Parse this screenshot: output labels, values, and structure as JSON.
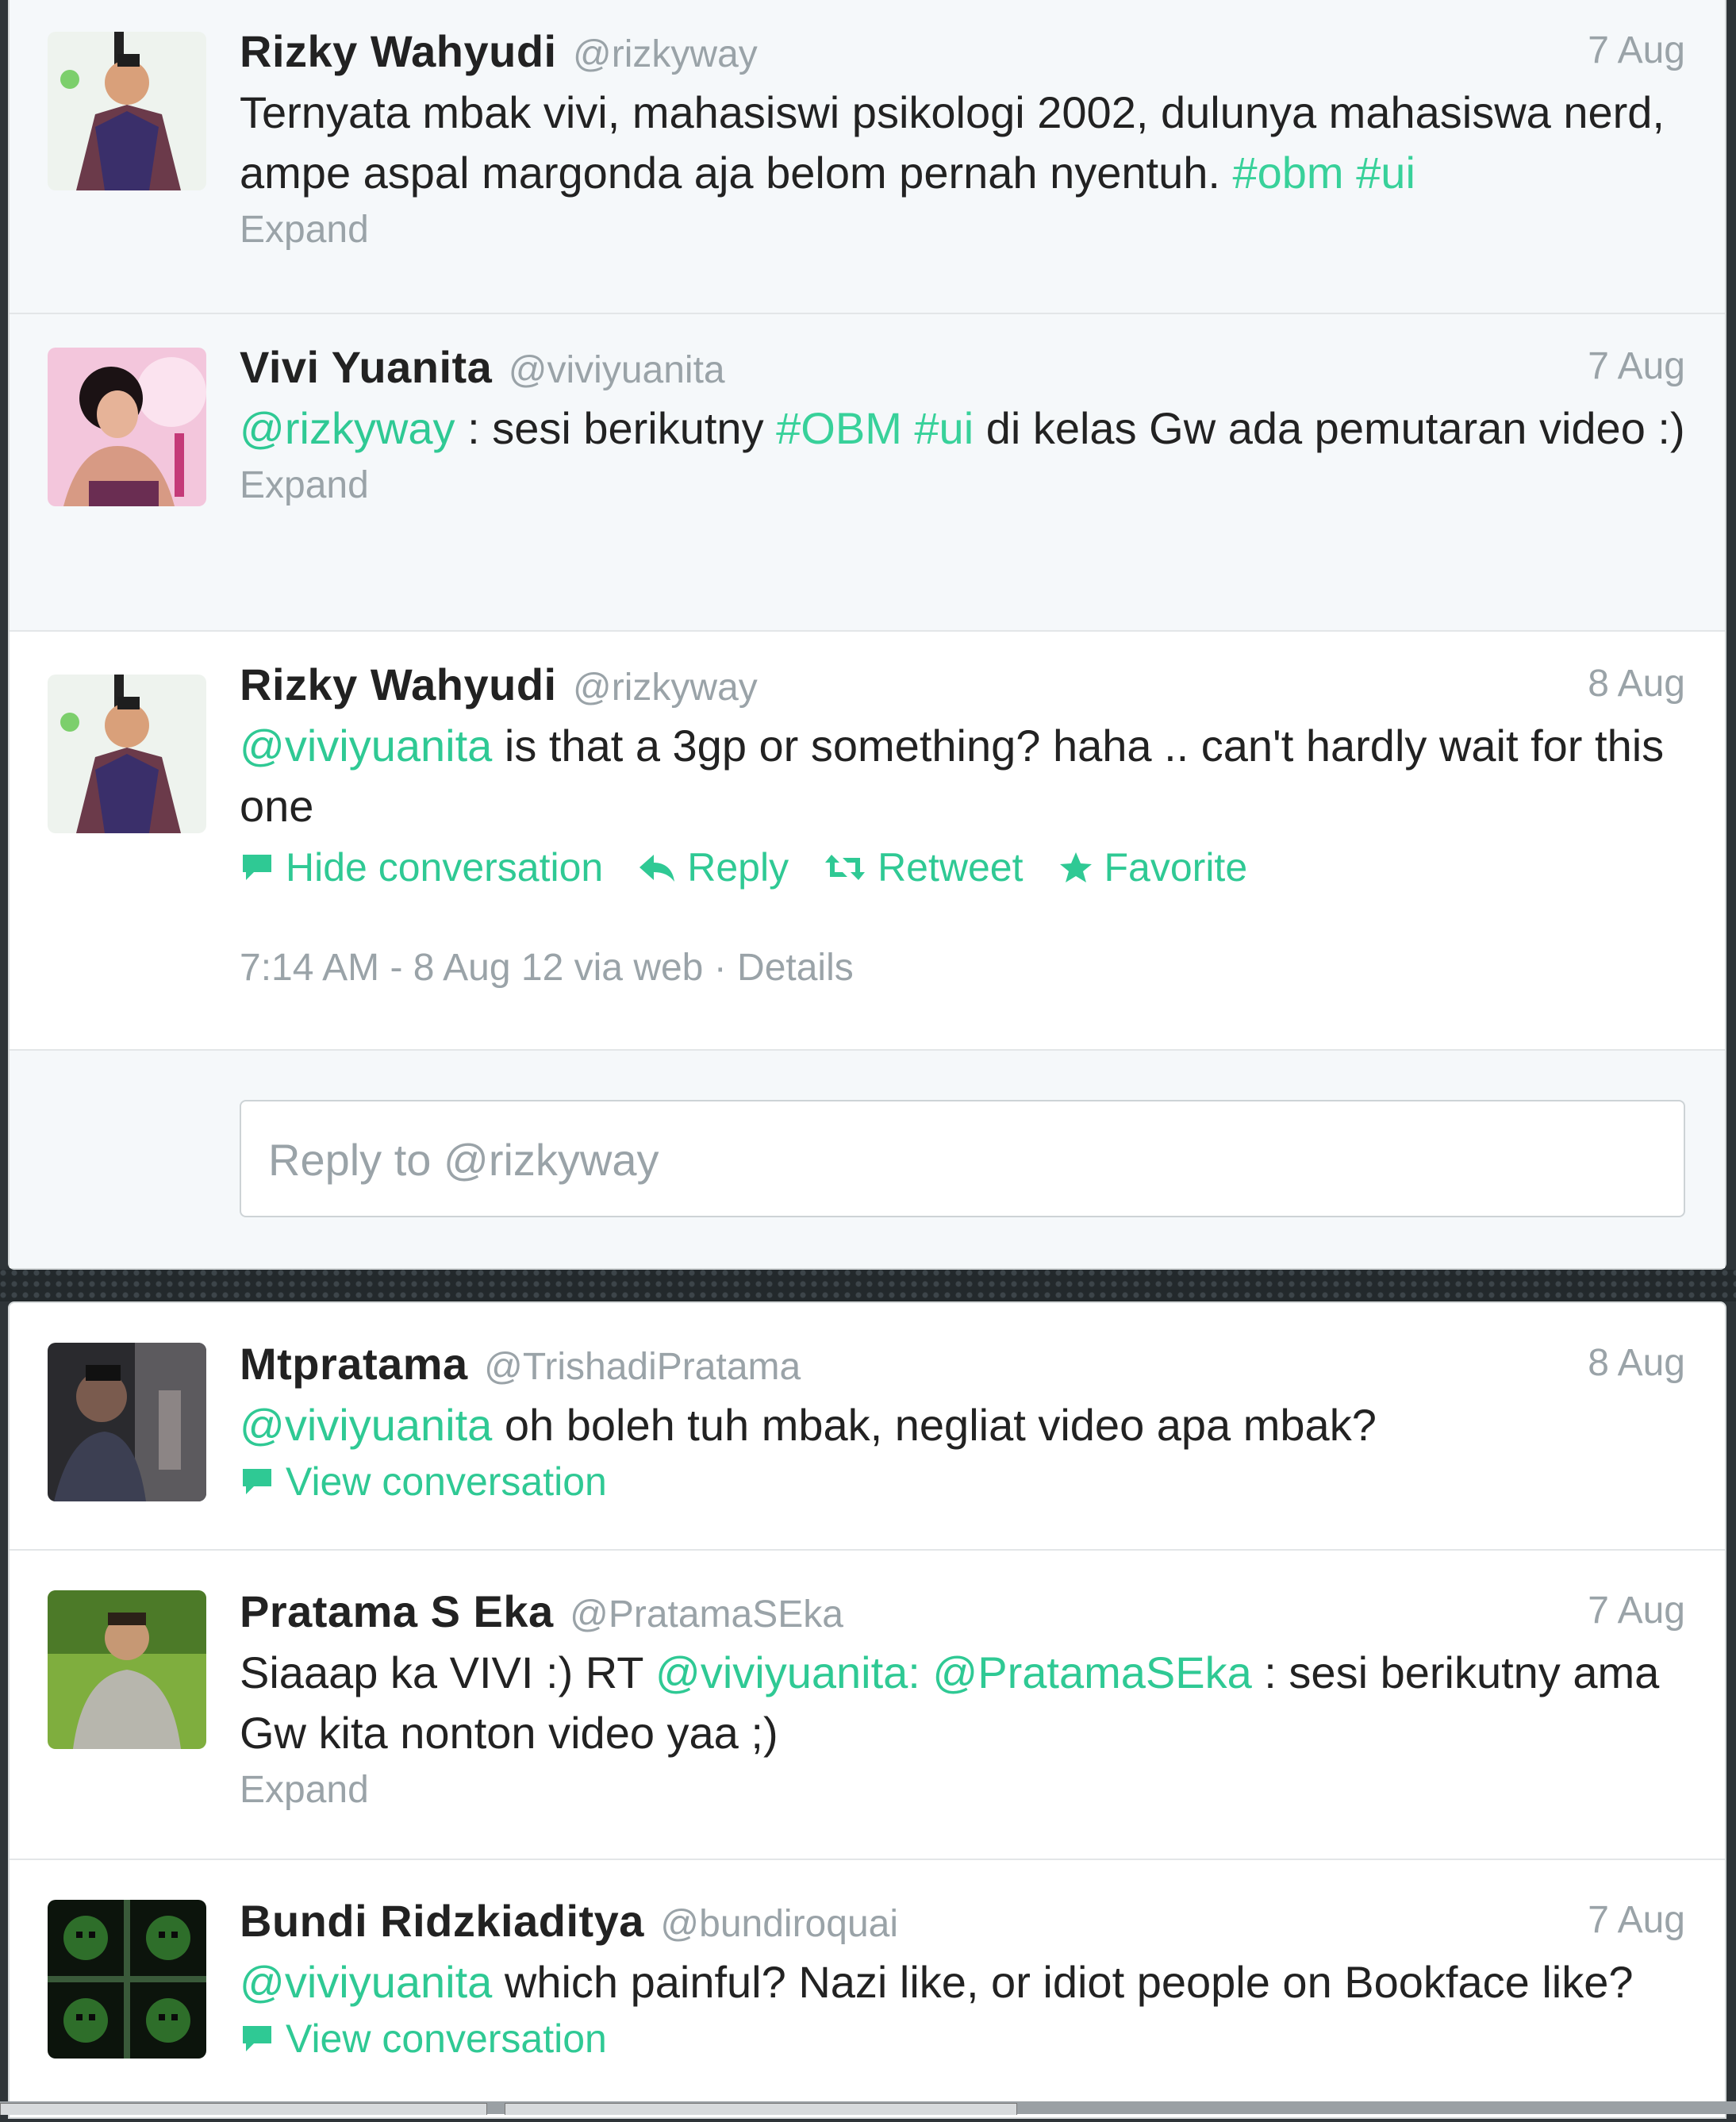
{
  "conversation": {
    "tweets": [
      {
        "name": "Rizky Wahyudi",
        "handle": "@rizkyway",
        "date": "7 Aug",
        "text_plain": "Ternyata mbak vivi, mahasiswi psikologi 2002, dulunya mahasiswa nerd, ampe aspal margonda aja belom pernah nyentuh.",
        "tags": [
          "#obm",
          "#ui"
        ],
        "expand": "Expand"
      },
      {
        "name": "Vivi Yuanita",
        "handle": "@viviyuanita",
        "date": "7 Aug",
        "mention": "@rizkyway",
        "text_a": " : sesi berikutny ",
        "tags": [
          "#OBM",
          "#ui"
        ],
        "text_b": " di kelas Gw ada pemutaran video :)",
        "expand": "Expand"
      },
      {
        "name": "Rizky Wahyudi",
        "handle": "@rizkyway",
        "date": "8 Aug",
        "mention": "@viviyuanita",
        "text": " is that a 3gp or something? haha .. can't hardly wait for this one",
        "actions": {
          "hide_conversation": "Hide conversation",
          "reply": "Reply",
          "retweet": "Retweet",
          "favorite": "Favorite"
        },
        "meta_time": "7:14 AM - 8 Aug 12 via web",
        "meta_sep": " · ",
        "meta_details": "Details"
      }
    ],
    "reply_placeholder": "Reply to @rizkyway"
  },
  "timeline": {
    "tweets": [
      {
        "name": "Mtpratama",
        "handle": "@TrishadiPratama",
        "date": "8 Aug",
        "mention": "@viviyuanita",
        "text": " oh boleh tuh mbak, negliat video apa mbak?",
        "view_conversation": "View conversation"
      },
      {
        "name": "Pratama S Eka",
        "handle": "@PratamaSEka",
        "date": "7 Aug",
        "text_a": "Siaaap ka VIVI :) RT ",
        "mention1": "@viviyuanita:",
        "mention2": "@PratamaSEka",
        "text_b": " : sesi berikutny ama Gw kita nonton video yaa ;)",
        "expand": "Expand"
      },
      {
        "name": "Bundi Ridzkiaditya",
        "handle": "@bundiroquai",
        "date": "7 Aug",
        "mention": "@viviyuanita",
        "text": " which painful? Nazi like, or idiot people on Bookface like?",
        "view_conversation": "View conversation"
      }
    ]
  },
  "colors": {
    "accent": "#2fc994",
    "muted": "#9aa3a8",
    "text": "#222222",
    "background": "#2e3438"
  }
}
